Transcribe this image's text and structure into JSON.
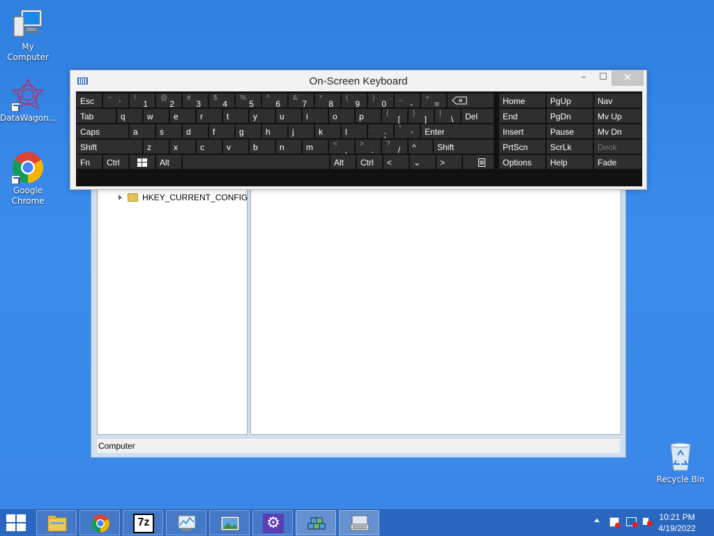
{
  "desktop": {
    "icons": [
      {
        "label": "My Computer"
      },
      {
        "label": "DataWagon..."
      },
      {
        "label": "Google Chrome"
      },
      {
        "label": "Recycle Bin"
      }
    ]
  },
  "regedit": {
    "tree_item": "HKEY_CURRENT_CONFIG",
    "status": "Computer"
  },
  "osk": {
    "title": "On-Screen Keyboard",
    "window_buttons": {
      "minimize": "–",
      "maximize": "☐",
      "close": "✕"
    },
    "keys": {
      "esc": "Esc",
      "tab": "Tab",
      "caps": "Caps",
      "shift": "Shift",
      "fn": "Fn",
      "ctrl": "Ctrl",
      "alt": "Alt",
      "del": "Del",
      "enter": "Enter",
      "home": "Home",
      "pgup": "PgUp",
      "nav": "Nav",
      "end": "End",
      "pgdn": "PgDn",
      "mvup": "Mv Up",
      "insert": "Insert",
      "pause": "Pause",
      "mvdn": "Mv Dn",
      "prtscn": "PrtScn",
      "scrlk": "ScrLk",
      "dock": "Dock",
      "options": "Options",
      "help": "Help",
      "fade": "Fade",
      "up": "^",
      "left": "<",
      "down": "⌄",
      "right": ">"
    },
    "row1": [
      {
        "sh": "~",
        "k": "`"
      },
      {
        "sh": "!",
        "k": "1"
      },
      {
        "sh": "@",
        "k": "2"
      },
      {
        "sh": "#",
        "k": "3"
      },
      {
        "sh": "$",
        "k": "4"
      },
      {
        "sh": "%",
        "k": "5"
      },
      {
        "sh": "^",
        "k": "6"
      },
      {
        "sh": "&",
        "k": "7"
      },
      {
        "sh": "*",
        "k": "8"
      },
      {
        "sh": "(",
        "k": "9"
      },
      {
        "sh": ")",
        "k": "0"
      },
      {
        "sh": "_",
        "k": "-"
      },
      {
        "sh": "+",
        "k": "="
      }
    ],
    "row2": [
      "q",
      "w",
      "e",
      "r",
      "t",
      "y",
      "u",
      "i",
      "o",
      "p"
    ],
    "row2_extra": [
      {
        "sh": "{",
        "k": "["
      },
      {
        "sh": "}",
        "k": "]"
      },
      {
        "sh": "|",
        "k": "\\"
      }
    ],
    "row3": [
      "a",
      "s",
      "d",
      "f",
      "g",
      "h",
      "j",
      "k",
      "l"
    ],
    "row3_extra": [
      {
        "sh": ":",
        "k": ";"
      },
      {
        "sh": "\"",
        "k": "'"
      }
    ],
    "row4": [
      "z",
      "x",
      "c",
      "v",
      "b",
      "n",
      "m"
    ],
    "row4_extra": [
      {
        "sh": "<",
        "k": ","
      },
      {
        "sh": ">",
        "k": "."
      },
      {
        "sh": "?",
        "k": "/"
      }
    ]
  },
  "taskbar": {
    "time": "10:21 PM",
    "date": "4/19/2022",
    "seven_zip": "7z"
  }
}
